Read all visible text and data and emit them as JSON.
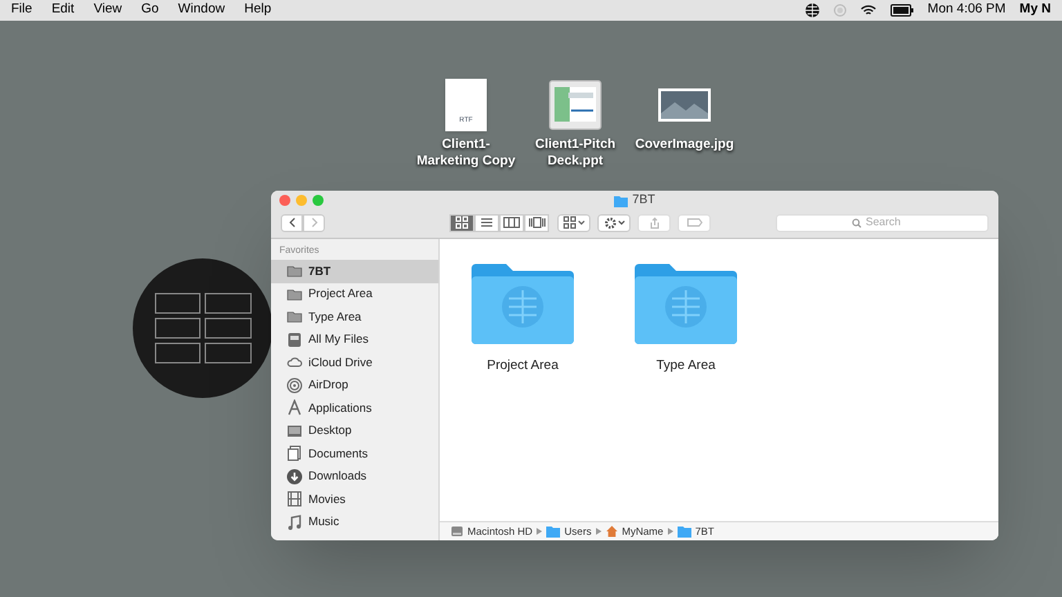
{
  "menu_bar": {
    "menus": [
      "File",
      "Edit",
      "View",
      "Go",
      "Window",
      "Help"
    ],
    "clock": "Mon 4:06 PM",
    "user": "My N"
  },
  "desktop_icons": [
    {
      "kind": "rtf",
      "label": "Client1-\nMarketing Copy",
      "badge": "RTF"
    },
    {
      "kind": "slides",
      "label": "Client1-Pitch\nDeck.ppt"
    },
    {
      "kind": "image",
      "label": "CoverImage.jpg"
    }
  ],
  "finder": {
    "title": "7BT",
    "search": {
      "placeholder": "Search"
    },
    "view_modes": [
      {
        "kind": "icons",
        "selected": true
      },
      {
        "kind": "list",
        "selected": false
      },
      {
        "kind": "columns",
        "selected": false
      },
      {
        "kind": "coverflow",
        "selected": false
      }
    ],
    "sidebar": {
      "heading": "Favorites",
      "items": [
        {
          "kind": "folder",
          "label": "7BT",
          "selected": true
        },
        {
          "kind": "folder",
          "label": "Project Area",
          "selected": false
        },
        {
          "kind": "folder",
          "label": "Type Area",
          "selected": false
        },
        {
          "kind": "files",
          "label": "All My Files",
          "selected": false
        },
        {
          "kind": "cloud",
          "label": "iCloud Drive",
          "selected": false
        },
        {
          "kind": "airdrop",
          "label": "AirDrop",
          "selected": false
        },
        {
          "kind": "apps",
          "label": "Applications",
          "selected": false
        },
        {
          "kind": "desktop",
          "label": "Desktop",
          "selected": false
        },
        {
          "kind": "documents",
          "label": "Documents",
          "selected": false
        },
        {
          "kind": "downloads",
          "label": "Downloads",
          "selected": false
        },
        {
          "kind": "movies",
          "label": "Movies",
          "selected": false
        },
        {
          "kind": "music",
          "label": "Music",
          "selected": false
        }
      ]
    },
    "folders": [
      {
        "label": "Project Area"
      },
      {
        "label": "Type Area"
      }
    ],
    "path": [
      {
        "kind": "disk",
        "label": "Macintosh HD"
      },
      {
        "kind": "folder",
        "label": "Users"
      },
      {
        "kind": "home",
        "label": "MyName"
      },
      {
        "kind": "folder",
        "label": "7BT"
      }
    ]
  }
}
